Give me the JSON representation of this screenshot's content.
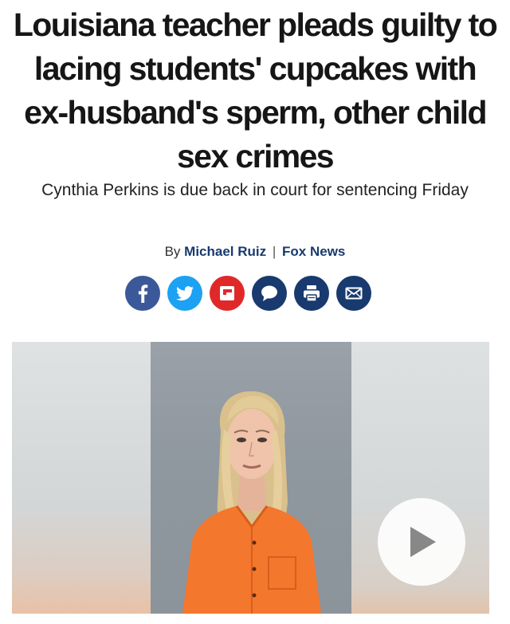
{
  "article": {
    "headline": "Louisiana teacher pleads guilty to lacing students' cupcakes with ex-husband's sperm, other child sex crimes",
    "subheadline": "Cynthia Perkins is due back in court for sentencing Friday",
    "byline": {
      "prefix": "By",
      "author": "Michael Ruiz",
      "separator": "|",
      "outlet": "Fox News"
    }
  },
  "share_buttons": [
    {
      "name": "facebook-icon",
      "color": "#3b5998"
    },
    {
      "name": "twitter-icon",
      "color": "#1da1f2"
    },
    {
      "name": "flipboard-icon",
      "color": "#e12828"
    },
    {
      "name": "comment-icon",
      "color": "#183a6e"
    },
    {
      "name": "print-icon",
      "color": "#183a6e"
    },
    {
      "name": "email-icon",
      "color": "#183a6e"
    }
  ],
  "media": {
    "play_icon": "play-icon",
    "play_color": "#888888"
  }
}
